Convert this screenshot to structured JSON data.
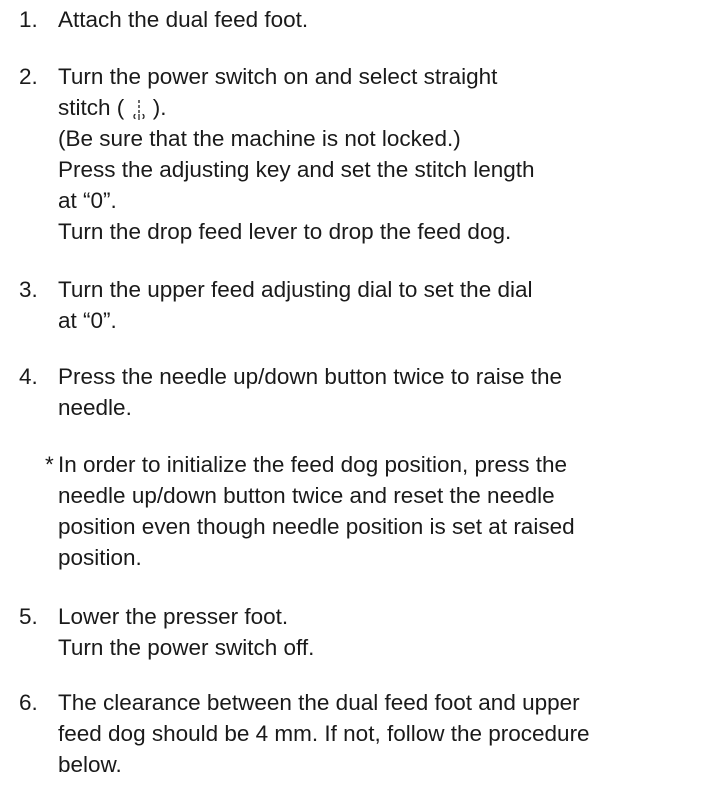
{
  "steps": [
    {
      "number": "1.",
      "lines": [
        "Attach the dual feed foot."
      ]
    },
    {
      "number": "2.",
      "line1": "Turn the power switch on and select straight",
      "line2_pre": "stitch ( ",
      "line2_icon": "straight-stitch-icon",
      "line2_post": " ).",
      "rest": [
        "(Be sure that the machine is not locked.)",
        "Press the adjusting key and set the stitch length",
        "at “0”.",
        "Turn the drop feed lever to drop the feed dog."
      ]
    },
    {
      "number": "3.",
      "lines": [
        "Turn the upper feed adjusting dial to set the dial",
        "at “0”."
      ]
    },
    {
      "number": "4.",
      "lines": [
        "Press the needle up/down button twice to raise the",
        "needle."
      ]
    },
    {
      "mark": "*",
      "lines": [
        "In order to initialize the feed dog position, press the",
        "needle up/down button twice and reset the needle",
        "position even though needle position is set at raised",
        "position."
      ]
    },
    {
      "number": "5.",
      "lines": [
        "Lower the presser foot.",
        "Turn the power switch off."
      ]
    },
    {
      "number": "6.",
      "lines": [
        "The clearance between the dual feed foot and upper",
        "feed dog should be 4 mm. If not, follow the procedure",
        "below."
      ]
    }
  ]
}
